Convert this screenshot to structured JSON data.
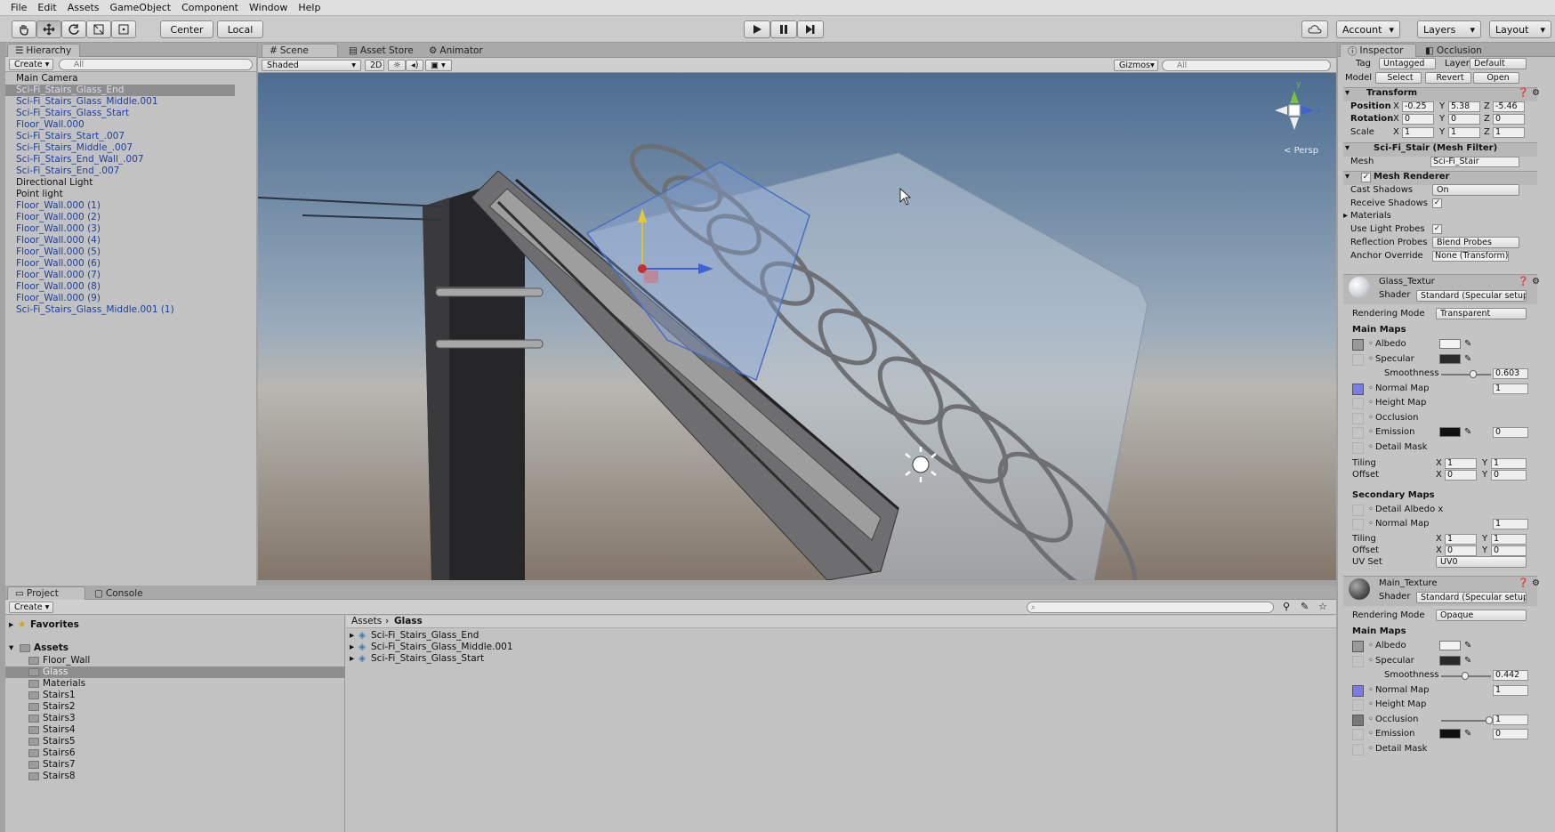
{
  "menu": [
    "File",
    "Edit",
    "Assets",
    "GameObject",
    "Component",
    "Window",
    "Help"
  ],
  "toolbar": {
    "pivot": "Center",
    "space": "Local",
    "account": "Account",
    "layers": "Layers",
    "layout": "Layout"
  },
  "hierarchy": {
    "tab": "Hierarchy",
    "create": "Create",
    "search": "All",
    "items": [
      {
        "label": "Main Camera",
        "blue": false
      },
      {
        "label": "Sci-Fi_Stairs_Glass_End",
        "blue": true,
        "selected": true
      },
      {
        "label": "Sci-Fi_Stairs_Glass_Middle.001",
        "blue": true
      },
      {
        "label": "Sci-Fi_Stairs_Glass_Start",
        "blue": true
      },
      {
        "label": "Floor_Wall.000",
        "blue": true
      },
      {
        "label": "Sci-Fi_Stairs_Start_.007",
        "blue": true
      },
      {
        "label": "Sci-Fi_Stairs_Middle_.007",
        "blue": true
      },
      {
        "label": "Sci-Fi_Stairs_End_Wall_.007",
        "blue": true
      },
      {
        "label": "Sci-Fi_Stairs_End_.007",
        "blue": true
      },
      {
        "label": "Directional Light",
        "blue": false
      },
      {
        "label": "Point light",
        "blue": false
      },
      {
        "label": "Floor_Wall.000 (1)",
        "blue": true
      },
      {
        "label": "Floor_Wall.000 (2)",
        "blue": true
      },
      {
        "label": "Floor_Wall.000 (3)",
        "blue": true
      },
      {
        "label": "Floor_Wall.000 (4)",
        "blue": true
      },
      {
        "label": "Floor_Wall.000 (5)",
        "blue": true
      },
      {
        "label": "Floor_Wall.000 (6)",
        "blue": true
      },
      {
        "label": "Floor_Wall.000 (7)",
        "blue": true
      },
      {
        "label": "Floor_Wall.000 (8)",
        "blue": true
      },
      {
        "label": "Floor_Wall.000 (9)",
        "blue": true
      },
      {
        "label": "Sci-Fi_Stairs_Glass_Middle.001 (1)",
        "blue": true
      }
    ]
  },
  "scene": {
    "tabs": [
      "Scene",
      "Asset Store",
      "Animator"
    ],
    "shading": "Shaded",
    "mode2d": "2D",
    "gizmos": "Gizmos",
    "search": "All",
    "persp": "Persp",
    "gizmo_axes": {
      "y": "y",
      "z": "z"
    }
  },
  "project": {
    "tabs": [
      "Project",
      "Console"
    ],
    "create": "Create",
    "favorites": "Favorites",
    "assets": "Assets",
    "folders": [
      "Floor_Wall",
      "Glass",
      "Materials",
      "Stairs1",
      "Stairs2",
      "Stairs3",
      "Stairs4",
      "Stairs5",
      "Stairs6",
      "Stairs7",
      "Stairs8"
    ],
    "selected_folder": "Glass",
    "breadcrumb": [
      "Assets",
      "Glass"
    ],
    "files": [
      "Sci-Fi_Stairs_Glass_End",
      "Sci-Fi_Stairs_Glass_Middle.001",
      "Sci-Fi_Stairs_Glass_Start"
    ]
  },
  "inspector": {
    "tabs": [
      "Inspector",
      "Occlusion"
    ],
    "tag_label": "Tag",
    "tag": "Untagged",
    "layer_label": "Layer",
    "layer": "Default",
    "model_label": "Model",
    "model_buttons": [
      "Select",
      "Revert",
      "Open"
    ],
    "transform": {
      "title": "Transform",
      "position": {
        "label": "Position",
        "x": "-0.25",
        "y": "5.38",
        "z": "-5.46"
      },
      "rotation": {
        "label": "Rotation",
        "x": "0",
        "y": "0",
        "z": "0"
      },
      "scale": {
        "label": "Scale",
        "x": "1",
        "y": "1",
        "z": "1"
      }
    },
    "mesh_filter": {
      "title": "Sci-Fi_Stair (Mesh Filter)",
      "mesh_label": "Mesh",
      "mesh": "Sci-Fi_Stair"
    },
    "mesh_renderer": {
      "title": "Mesh Renderer",
      "cast_shadows_label": "Cast Shadows",
      "cast_shadows": "On",
      "receive_shadows": "Receive Shadows",
      "materials": "Materials",
      "light_probes": "Use Light Probes",
      "reflection_label": "Reflection Probes",
      "reflection": "Blend Probes",
      "anchor_label": "Anchor Override",
      "anchor": "None (Transform)"
    },
    "mat1": {
      "name": "Glass_Textur",
      "shader_label": "Shader",
      "shader": "Standard (Specular setup)",
      "rendering_label": "Rendering Mode",
      "rendering": "Transparent",
      "main_maps": "Main Maps",
      "albedo": "Albedo",
      "specular": "Specular",
      "smoothness_label": "Smoothness",
      "smoothness": "0.603",
      "normal": "Normal Map",
      "normal_val": "1",
      "height": "Height Map",
      "occlusion": "Occlusion",
      "emission": "Emission",
      "emission_val": "0",
      "detail": "Detail Mask",
      "tiling": "Tiling",
      "tiling_x": "1",
      "tiling_y": "1",
      "offset": "Offset",
      "offset_x": "0",
      "offset_y": "0",
      "secondary": "Secondary Maps",
      "detail_albedo": "Detail Albedo x",
      "normal2": "Normal Map",
      "normal2_val": "1",
      "tiling2_x": "1",
      "tiling2_y": "1",
      "offset2_x": "0",
      "offset2_y": "0",
      "uv_label": "UV Set",
      "uv": "UV0"
    },
    "mat2": {
      "name": "Main_Texture",
      "shader_label": "Shader",
      "shader": "Standard (Specular setup)",
      "rendering_label": "Rendering Mode",
      "rendering": "Opaque",
      "main_maps": "Main Maps",
      "albedo": "Albedo",
      "specular": "Specular",
      "smoothness_label": "Smoothness",
      "smoothness": "0.442",
      "normal": "Normal Map",
      "normal_val": "1",
      "height": "Height Map",
      "occlusion": "Occlusion",
      "occlusion_val": "1",
      "emission": "Emission",
      "emission_val": "0",
      "detail": "Detail Mask"
    },
    "axis": {
      "x": "X",
      "y": "Y",
      "z": "Z"
    }
  },
  "colors": {
    "normal_map": "#7a7aea",
    "selection": "#8e8e8e",
    "prefab_blue": "#1c3fa0"
  }
}
